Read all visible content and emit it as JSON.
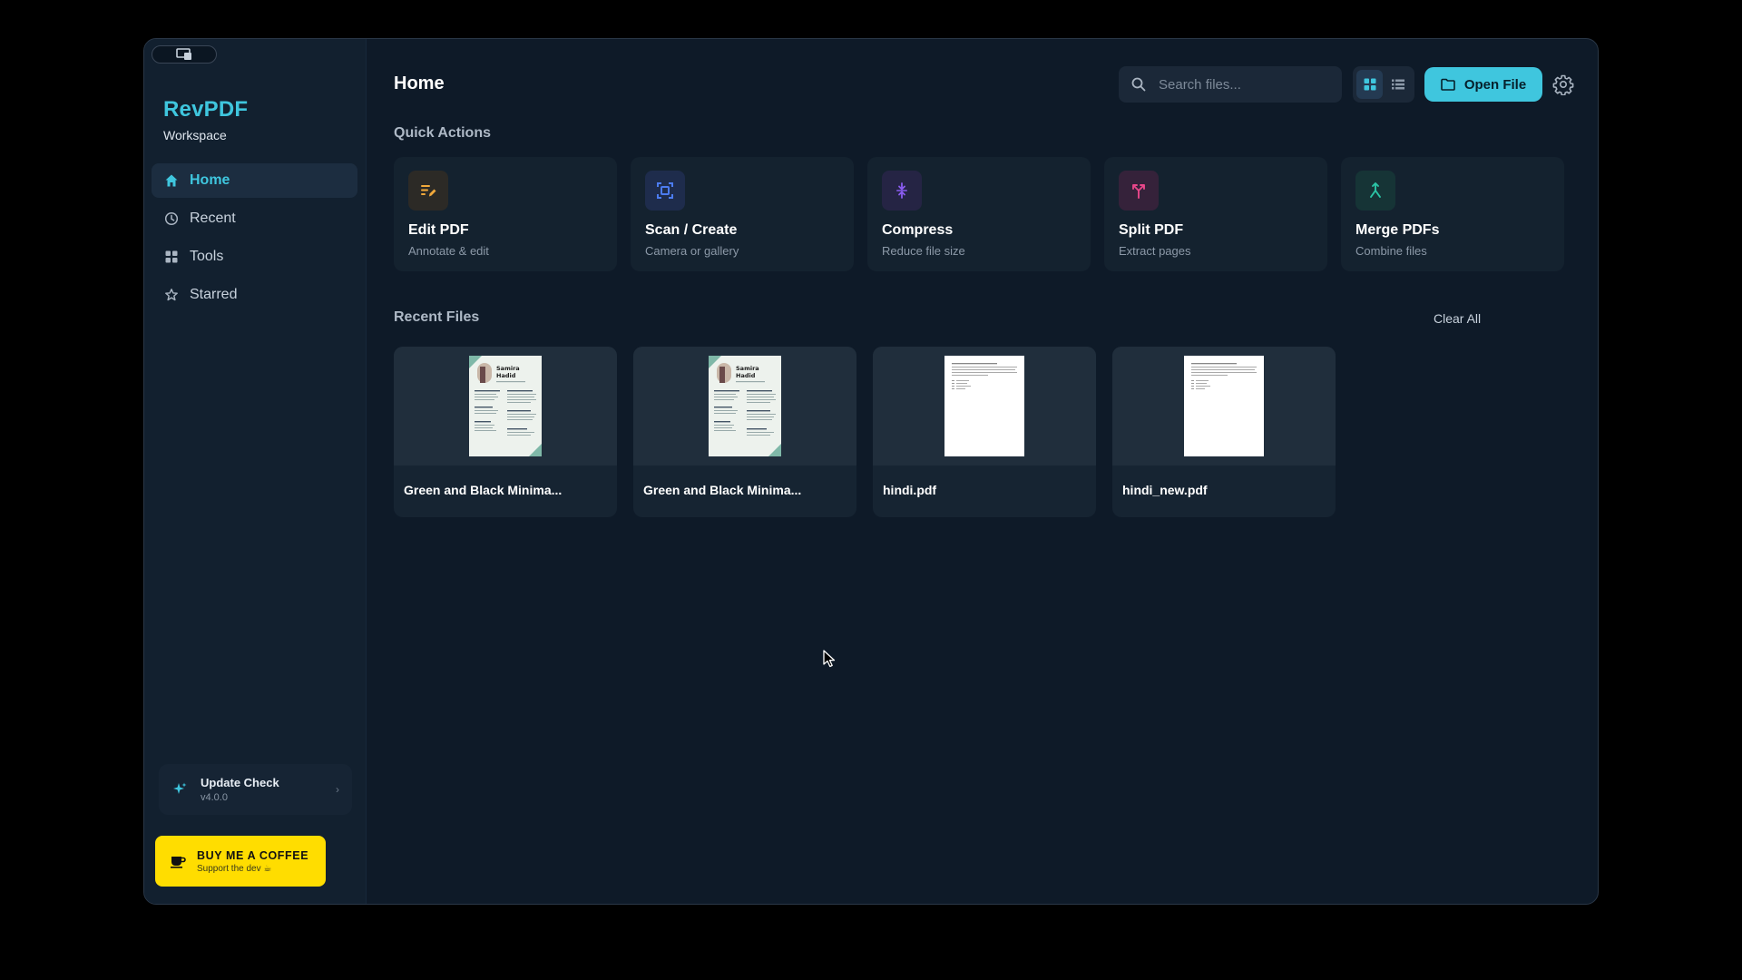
{
  "app": {
    "name": "RevPDF",
    "workspace": "Workspace"
  },
  "sidebar": {
    "items": [
      {
        "label": "Home",
        "icon": "home-icon",
        "active": true
      },
      {
        "label": "Recent",
        "icon": "clock-icon",
        "active": false
      },
      {
        "label": "Tools",
        "icon": "grid-icon",
        "active": false
      },
      {
        "label": "Starred",
        "icon": "star-icon",
        "active": false
      }
    ],
    "update": {
      "title": "Update Check",
      "version": "v4.0.0"
    },
    "coffee": {
      "title": "BUY ME A COFFEE",
      "subtitle": "Support the dev ☕"
    }
  },
  "header": {
    "title": "Home",
    "search_placeholder": "Search files...",
    "open_file_label": "Open File"
  },
  "quick_actions": {
    "title": "Quick Actions",
    "items": [
      {
        "title": "Edit PDF",
        "subtitle": "Annotate & edit",
        "icon": "edit-icon",
        "color": "#f2a93b",
        "bg": "#2c2a26"
      },
      {
        "title": "Scan / Create",
        "subtitle": "Camera or gallery",
        "icon": "scan-icon",
        "color": "#4c7cf0",
        "bg": "#1e2c4c"
      },
      {
        "title": "Compress",
        "subtitle": "Reduce file size",
        "icon": "compress-icon",
        "color": "#8a5cf0",
        "bg": "#252444"
      },
      {
        "title": "Split PDF",
        "subtitle": "Extract pages",
        "icon": "split-icon",
        "color": "#e8468a",
        "bg": "#35223a"
      },
      {
        "title": "Merge PDFs",
        "subtitle": "Combine files",
        "icon": "merge-icon",
        "color": "#2bc5a6",
        "bg": "#163436"
      }
    ]
  },
  "recent": {
    "title": "Recent Files",
    "clear_label": "Clear All",
    "files": [
      {
        "name": "Green and Black Minima...",
        "thumb": "resume",
        "resume_name": "Samira Hadid"
      },
      {
        "name": "Green and Black Minima...",
        "thumb": "resume",
        "resume_name": "Samira Hadid"
      },
      {
        "name": "hindi.pdf",
        "thumb": "plain"
      },
      {
        "name": "hindi_new.pdf",
        "thumb": "plain"
      }
    ]
  },
  "colors": {
    "accent": "#3fc6de",
    "background": "#0e1a28",
    "sidebar": "#12202f",
    "coffee": "#ffdd00"
  }
}
